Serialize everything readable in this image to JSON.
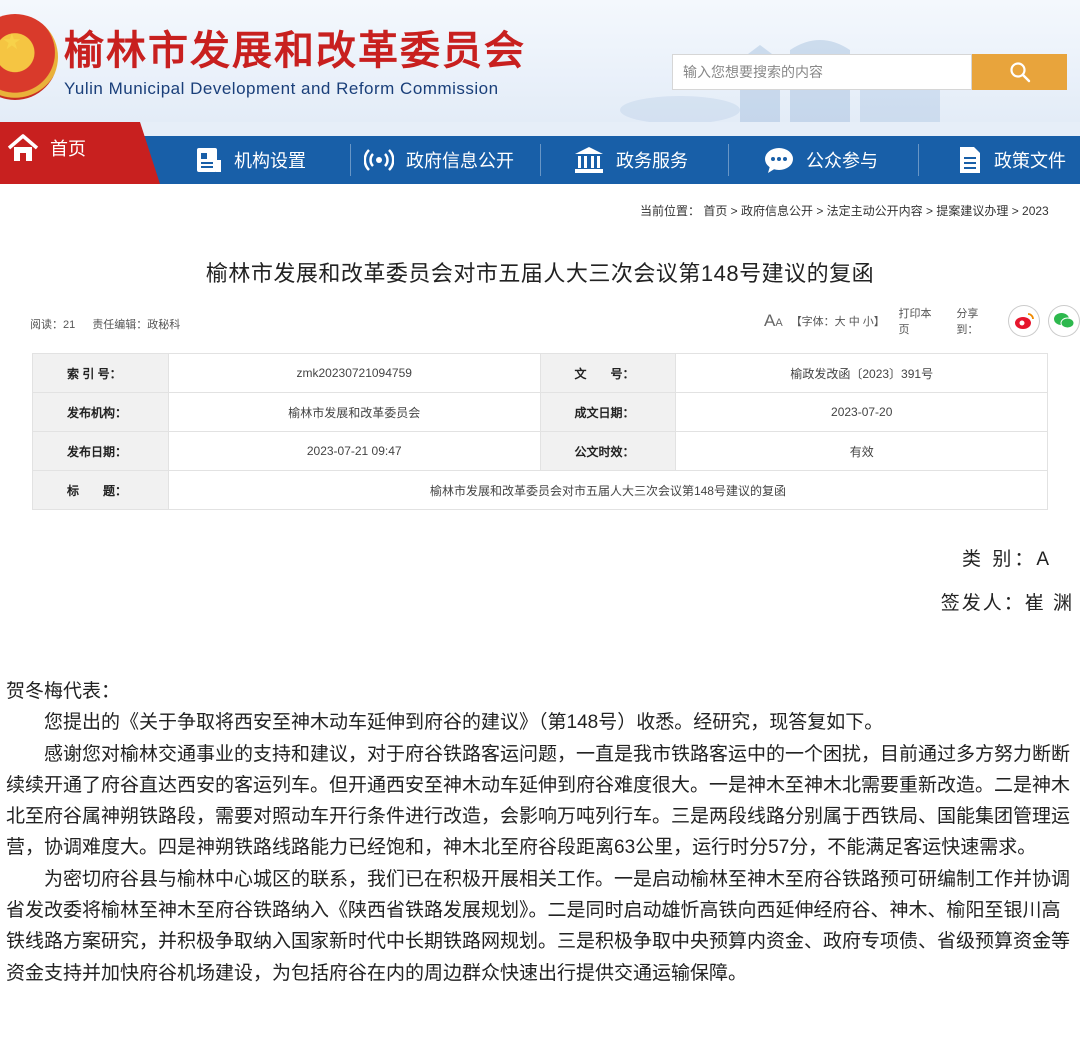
{
  "header": {
    "title_cn": "榆林市发展和改革委员会",
    "title_en": "Yulin Municipal Development and Reform Commission",
    "search_placeholder": "输入您想要搜索的内容",
    "brand_red": "#c8201f",
    "brand_blue": "#185fa8",
    "search_btn_color": "#e8a43c"
  },
  "nav": {
    "home": "首页",
    "items": [
      "机构设置",
      "政府信息公开",
      "政务服务",
      "公众参与",
      "政策文件"
    ],
    "icons": [
      "home-icon",
      "org-chart-icon",
      "broadcast-icon",
      "government-building-icon",
      "chat-icon",
      "document-icon"
    ]
  },
  "breadcrumb": "当前位置： 首页 > 政府信息公开 > 法定主动公开内容 > 提案建议办理 > 2023",
  "article": {
    "title": "榆林市发展和改革委员会对市五届人大三次会议第148号建议的复函",
    "reads": "阅读：21",
    "editor": "责任编辑：政秘科",
    "font_size_label": "【字体：大 中 小】",
    "print": "打印本页",
    "share": "分享到："
  },
  "info": {
    "index_label": "索 引 号：",
    "index_value": "zmk20230721094759",
    "doc_no_label": "文　　号：",
    "doc_no_value": "榆政发改函〔2023〕391号",
    "publisher_label": "发布机构：",
    "publisher_value": "榆林市发展和改革委员会",
    "written_date_label": "成文日期：",
    "written_date_value": "2023-07-20",
    "publish_date_label": "发布日期：",
    "publish_date_value": "2023-07-21 09:47",
    "validity_label": "公文时效：",
    "validity_value": "有效",
    "title_label": "标　　题：",
    "title_value": "榆林市发展和改革委员会对市五届人大三次会议第148号建议的复函"
  },
  "letter": {
    "category": "类 别：A",
    "signer": "签发人：崔 渊",
    "salutation": "贺冬梅代表：",
    "p1": "您提出的《关于争取将西安至神木动车延伸到府谷的建议》（第148号）收悉。经研究，现答复如下。",
    "p2": "感谢您对榆林交通事业的支持和建议，对于府谷铁路客运问题，一直是我市铁路客运中的一个困扰，目前通过多方努力断断续续开通了府谷直达西安的客运列车。但开通西安至神木动车延伸到府谷难度很大。一是神木至神木北需要重新改造。二是神木北至府谷属神朔铁路段，需要对照动车开行条件进行改造，会影响万吨列行车。三是两段线路分别属于西铁局、国能集团管理运营，协调难度大。四是神朔铁路线路能力已经饱和，神木北至府谷段距离63公里，运行时分57分，不能满足客运快速需求。",
    "p3": "为密切府谷县与榆林中心城区的联系，我们已在积极开展相关工作。一是启动榆林至神木至府谷铁路预可研编制工作并协调省发改委将榆林至神木至府谷铁路纳入《陕西省铁路发展规划》。二是同时启动雄忻高铁向西延伸经府谷、神木、榆阳至银川高铁线路方案研究，并积极争取纳入国家新时代中长期铁路网规划。三是积极争取中央预算内资金、政府专项债、省级预算资金等资金支持并加快府谷机场建设，为包括府谷在内的周边群众快速出行提供交通运输保障。"
  }
}
